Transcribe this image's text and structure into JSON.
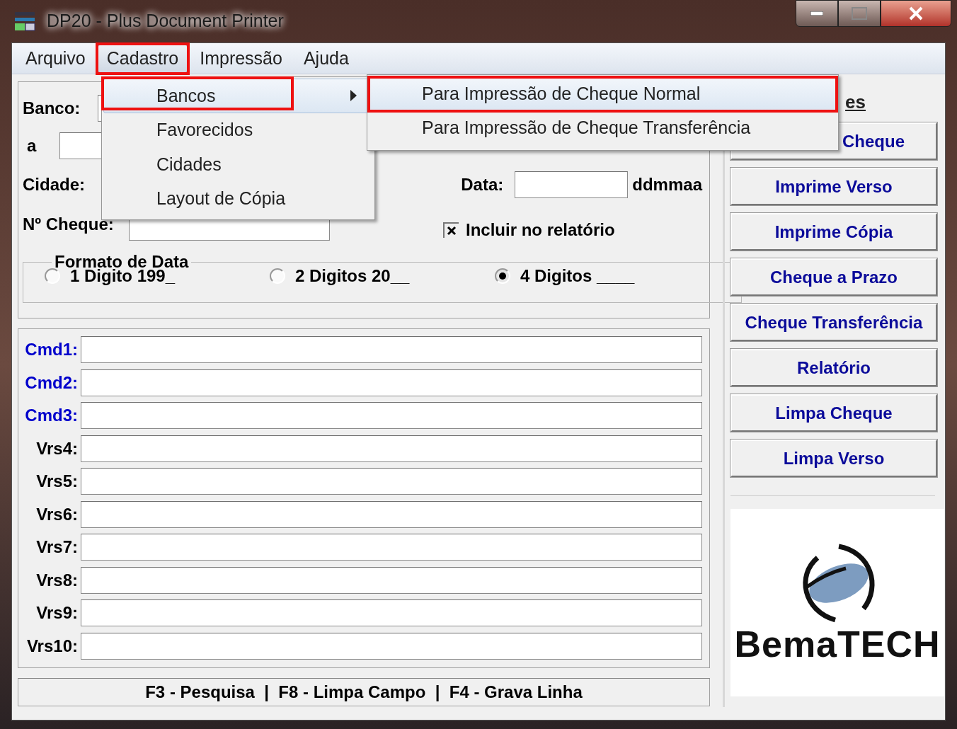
{
  "window": {
    "title": "DP20 - Plus Document Printer"
  },
  "menu_bar": [
    {
      "label": "Arquivo",
      "selected": false,
      "annotated": false
    },
    {
      "label": "Cadastro",
      "selected": true,
      "annotated": true
    },
    {
      "label": "Impressão",
      "selected": false,
      "annotated": false
    },
    {
      "label": "Ajuda",
      "selected": false,
      "annotated": false
    }
  ],
  "dropdown": [
    {
      "label": "Bancos",
      "selected": true,
      "annotated": true,
      "has_submenu": true
    },
    {
      "label": "Favorecidos",
      "selected": false,
      "annotated": false,
      "has_submenu": false
    },
    {
      "label": "Cidades",
      "selected": false,
      "annotated": false,
      "has_submenu": false
    },
    {
      "label": "Layout de Cópia",
      "selected": false,
      "annotated": false,
      "has_submenu": false
    }
  ],
  "submenu": [
    {
      "label": "Para Impressão de Cheque Normal",
      "selected": true,
      "annotated": true
    },
    {
      "label": "Para Impressão de Cheque Transferência",
      "selected": false,
      "annotated": false
    }
  ],
  "form": {
    "banco_label": "Banco:",
    "a_label": "a",
    "cidade_label": "Cidade:",
    "data_label": "Data:",
    "data_hint": "ddmmaa",
    "cheque_label": "Nº Cheque:",
    "include": {
      "label": "Incluir no relatório",
      "checked": true
    },
    "date_format": {
      "title": "Formato de Data",
      "options": [
        {
          "label": "1 Digito 199_",
          "selected": false
        },
        {
          "label": "2 Digitos 20__",
          "selected": false
        },
        {
          "label": "4 Digitos ____",
          "selected": true
        }
      ]
    }
  },
  "lines": [
    {
      "label": "Cmd1:",
      "color": "#0000cc"
    },
    {
      "label": "Cmd2:",
      "color": "#0000cc"
    },
    {
      "label": "Cmd3:",
      "color": "#0000cc"
    },
    {
      "label": "Vrs4:",
      "color": "#000000"
    },
    {
      "label": "Vrs5:",
      "color": "#000000"
    },
    {
      "label": "Vrs6:",
      "color": "#000000"
    },
    {
      "label": "Vrs7:",
      "color": "#000000"
    },
    {
      "label": "Vrs8:",
      "color": "#000000"
    },
    {
      "label": "Vrs9:",
      "color": "#000000"
    },
    {
      "label": "Vrs10:",
      "color": "#000000"
    }
  ],
  "status_bar": "F3 - Pesquisa  |  F8 - Limpa Campo  |  F4 - Grava Linha",
  "side": {
    "heading": "es",
    "buttons": [
      {
        "label": "Cheque"
      },
      {
        "label": "Imprime Verso"
      },
      {
        "label": "Imprime Cópia"
      },
      {
        "label": "Cheque a Prazo"
      },
      {
        "label": "Cheque Transferência"
      },
      {
        "label": "Relatório"
      },
      {
        "label": "Limpa Cheque"
      },
      {
        "label": "Limpa Verso"
      }
    ]
  },
  "logo": {
    "text": "BemaTECH"
  }
}
